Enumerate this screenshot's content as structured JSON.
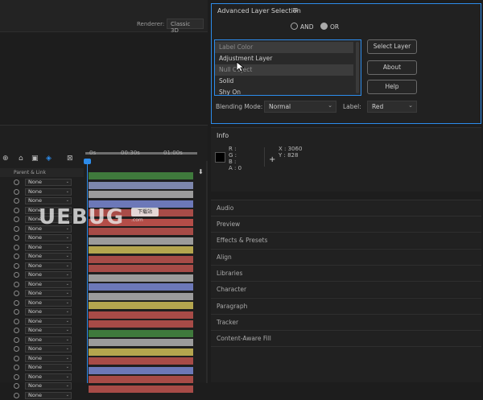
{
  "comp_bar": {
    "renderer_label": "Renderer:",
    "renderer_value": "Classic 3D"
  },
  "advanced_layer_selection": {
    "title": "Advanced Layer Selection",
    "menu_icon": "hamburger-icon",
    "mode_and": "AND",
    "mode_or": "OR",
    "selected_mode": "OR",
    "list_items": [
      "Label Color",
      "Adjustment Layer",
      "Null Object",
      "Solid",
      "Shy On"
    ],
    "highlighted_items": [
      "Label Color",
      "Null Object"
    ],
    "buttons": {
      "select": "Select Layer",
      "about": "About",
      "help": "Help"
    },
    "blending_mode_label": "Blending Mode:",
    "blending_mode_value": "Normal",
    "label_label": "Label:",
    "label_value": "Red"
  },
  "info": {
    "title": "Info",
    "r": "R :",
    "g": "G :",
    "b": "B :",
    "a": "A : 0",
    "x": "X : 3060",
    "y": "Y : 828"
  },
  "panels": [
    "Audio",
    "Preview",
    "Effects & Presets",
    "Align",
    "Libraries",
    "Character",
    "Paragraph",
    "Tracker",
    "Content-Aware Fill"
  ],
  "timeline": {
    "column_header": "Parent & Link",
    "parent_value": "None",
    "ruler_labels": [
      "0s",
      "00:30s",
      "01:00s"
    ],
    "track_colors": [
      "#3f7a3c",
      "#7d86ac",
      "#9b9b9b",
      "#6c78b8",
      "#a84c48",
      "#b44d48",
      "#a74b47",
      "#9b9b9b",
      "#b4a54e",
      "#a74b47",
      "#a74b47",
      "#9b9b9b",
      "#6c78b8",
      "#9b9b9b",
      "#b4a54e",
      "#a74b47",
      "#a74b47",
      "#3f7a3c",
      "#9b9b9b",
      "#b4a54e",
      "#a74b47",
      "#6c78b8",
      "#a74b47",
      "#a74b47"
    ]
  },
  "watermark": {
    "text": "UEBUG",
    "badge": "下载站",
    "sub": ".com"
  }
}
